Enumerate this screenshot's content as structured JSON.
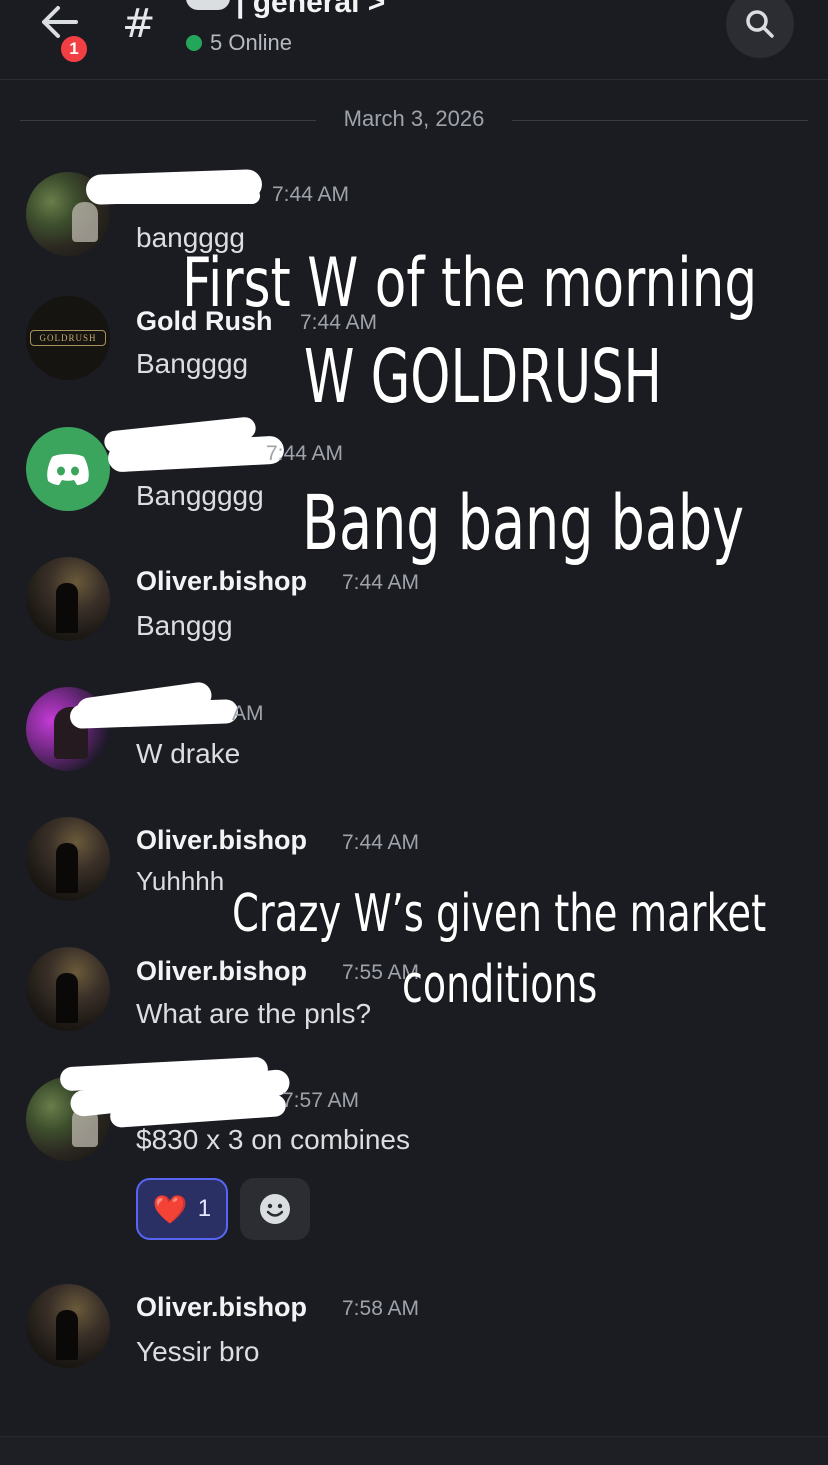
{
  "header": {
    "channel_name": "| general >",
    "notification_count": "1",
    "online_text": "5 Online"
  },
  "date_divider": "March 3, 2026",
  "messages": [
    {
      "author": "",
      "time": "7:44 AM",
      "text": "bangggg"
    },
    {
      "author": "Gold Rush",
      "time": "7:44 AM",
      "text": "Bangggg",
      "avatar_text": "GOLDRUSH"
    },
    {
      "author": "",
      "time": "7:44 AM",
      "text": "Banggggg"
    },
    {
      "author": "Oliver.bishop",
      "time": "7:44 AM",
      "text": "Banggg"
    },
    {
      "author": "",
      "time": "AM",
      "text": "W drake"
    },
    {
      "author": "Oliver.bishop",
      "time": "7:44 AM",
      "text": "Yuhhhh"
    },
    {
      "author": "Oliver.bishop",
      "time": "7:55 AM",
      "text": "What are the pnls?"
    },
    {
      "author": "",
      "time": "7:57 AM",
      "text": "$830 x 3 on combines"
    },
    {
      "author": "Oliver.bishop",
      "time": "7:58 AM",
      "text": "Yessir bro"
    }
  ],
  "reactions": [
    {
      "emoji": "❤️",
      "count": "1"
    }
  ],
  "overlays": {
    "line1": "First W of the morning",
    "line2": "W GOLDRUSH",
    "line3": "Bang bang baby",
    "line4": "Crazy W’s given the market",
    "line5": "conditions"
  },
  "colors": {
    "background": "#1b1c21",
    "online": "#23a55a",
    "badge": "#f23f43",
    "reaction_border": "#5865f2",
    "discord_avatar": "#3ba55d"
  }
}
